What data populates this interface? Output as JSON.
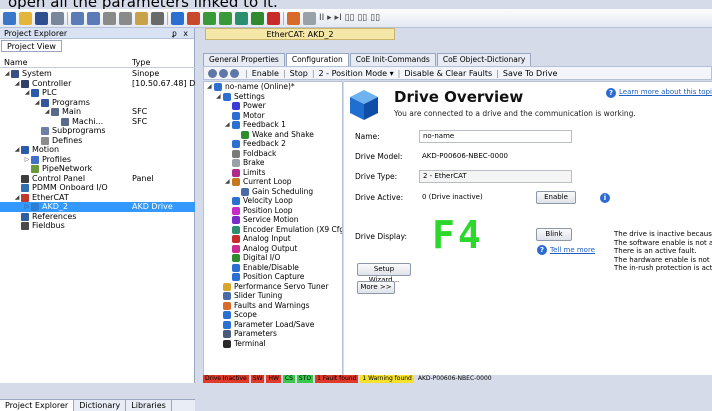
{
  "header_text": "open all the parameters linked to it.",
  "toolbar": {
    "mode_text": "II ▸ ▸I ▯▯ ▯▯ ▯▯"
  },
  "left_pane": {
    "title": "Project Explorer",
    "pin_text": "ᵱ x",
    "view_tab": "Project View",
    "col_name": "Name",
    "col_type": "Type",
    "tree": [
      {
        "label": "System",
        "type": "Sinope",
        "indent": 0,
        "arrow": "◢",
        "icon": "#3a4f85"
      },
      {
        "label": "Controller",
        "type": "[10.50.67.48] Drive",
        "indent": 1,
        "arrow": "◢",
        "icon": "#2f3f66"
      },
      {
        "label": "PLC",
        "type": "",
        "indent": 2,
        "arrow": "◢",
        "icon": "#2a5aa8"
      },
      {
        "label": "Programs",
        "type": "",
        "indent": 3,
        "arrow": "◢",
        "icon": "#33559b"
      },
      {
        "label": "Main",
        "type": "SFC",
        "indent": 4,
        "arrow": "◢",
        "icon": "#5a6a8a"
      },
      {
        "label": "Machi...",
        "type": "SFC",
        "indent": 5,
        "arrow": "",
        "icon": "#5a6a8a"
      },
      {
        "label": "Subprograms",
        "type": "",
        "indent": 3,
        "arrow": "",
        "icon": "#6d7fa5"
      },
      {
        "label": "Defines",
        "type": "",
        "indent": 3,
        "arrow": "",
        "icon": "#8c8c8c"
      },
      {
        "label": "Motion",
        "type": "",
        "indent": 1,
        "arrow": "◢",
        "icon": "#2a5aa8"
      },
      {
        "label": "Profiles",
        "type": "",
        "indent": 2,
        "arrow": "▷",
        "icon": "#4070c8"
      },
      {
        "label": "PipeNetwork",
        "type": "",
        "indent": 2,
        "arrow": "",
        "icon": "#6a9a3a"
      },
      {
        "label": "Control Panel",
        "type": "Panel",
        "indent": 1,
        "arrow": "",
        "icon": "#3d3d3d"
      },
      {
        "label": "PDMM Onboard I/O",
        "type": "",
        "indent": 1,
        "arrow": "",
        "icon": "#2f6fb3"
      },
      {
        "label": "EtherCAT",
        "type": "",
        "indent": 1,
        "arrow": "◢",
        "icon": "#c0392b"
      },
      {
        "label": "AKD_2",
        "type": "AKD Drive",
        "indent": 2,
        "arrow": "▷",
        "icon": "#2b7fd3",
        "selected": true
      },
      {
        "label": "References",
        "type": "",
        "indent": 1,
        "arrow": "",
        "icon": "#2f5fa0"
      },
      {
        "label": "Fieldbus",
        "type": "",
        "indent": 1,
        "arrow": "",
        "icon": "#4a4a4a"
      }
    ],
    "bottom_tabs": [
      "Project Explorer",
      "Dictionary",
      "Libraries"
    ]
  },
  "doc_tab": "EtherCAT: AKD_2",
  "tabs": [
    "General Properties",
    "Configuration",
    "CoE Init-Commands",
    "CoE Object-Dictionary"
  ],
  "active_tab": 1,
  "cmdbar": {
    "enable": "Enable",
    "stop": "Stop",
    "mode": "2 - Position Mode ▾",
    "disable": "Disable & Clear Faults",
    "save": "Save To Drive"
  },
  "inner_tree": [
    {
      "label": "no-name (Online)*",
      "indent": 0,
      "arrow": "◢",
      "icon": "#2b6fd1"
    },
    {
      "label": "Settings",
      "indent": 1,
      "arrow": "◢",
      "icon": "#2b6fd1"
    },
    {
      "label": "Power",
      "indent": 2,
      "arrow": "",
      "icon": "#3a3ad6"
    },
    {
      "label": "Motor",
      "indent": 2,
      "arrow": "",
      "icon": "#2b6fd1"
    },
    {
      "label": "Feedback 1",
      "indent": 2,
      "arrow": "◢",
      "icon": "#2b6fd1"
    },
    {
      "label": "Wake and Shake",
      "indent": 3,
      "arrow": "",
      "icon": "#2e8b2e"
    },
    {
      "label": "Feedback 2",
      "indent": 2,
      "arrow": "",
      "icon": "#2b6fd1"
    },
    {
      "label": "Foldback",
      "indent": 2,
      "arrow": "",
      "icon": "#7a7a7a"
    },
    {
      "label": "Brake",
      "indent": 2,
      "arrow": "",
      "icon": "#9aa0a8"
    },
    {
      "label": "Limits",
      "indent": 2,
      "arrow": "",
      "icon": "#b02a8a"
    },
    {
      "label": "Current Loop",
      "indent": 2,
      "arrow": "◢",
      "icon": "#c47a1a"
    },
    {
      "label": "Gain Scheduling",
      "indent": 3,
      "arrow": "",
      "icon": "#4a6aa8"
    },
    {
      "label": "Velocity Loop",
      "indent": 2,
      "arrow": "",
      "icon": "#2b6fd1"
    },
    {
      "label": "Position Loop",
      "indent": 2,
      "arrow": "",
      "icon": "#c92bc9"
    },
    {
      "label": "Service Motion",
      "indent": 2,
      "arrow": "",
      "icon": "#7a2bc9"
    },
    {
      "label": "Encoder Emulation (X9 Cfg)",
      "indent": 2,
      "arrow": "",
      "icon": "#2b8f6f"
    },
    {
      "label": "Analog Input",
      "indent": 2,
      "arrow": "",
      "icon": "#c92b2b"
    },
    {
      "label": "Analog Output",
      "indent": 2,
      "arrow": "",
      "icon": "#c92b8f"
    },
    {
      "label": "Digital I/O",
      "indent": 2,
      "arrow": "",
      "icon": "#2e8b2e"
    },
    {
      "label": "Enable/Disable",
      "indent": 2,
      "arrow": "",
      "icon": "#2b6fd1"
    },
    {
      "label": "Position Capture",
      "indent": 2,
      "arrow": "",
      "icon": "#2b6fd1"
    },
    {
      "label": "Performance Servo Tuner",
      "indent": 1,
      "arrow": "",
      "icon": "#d8a62b"
    },
    {
      "label": "Slider Tuning",
      "indent": 1,
      "arrow": "",
      "icon": "#4a6aa8"
    },
    {
      "label": "Faults and Warnings",
      "indent": 1,
      "arrow": "",
      "icon": "#d86a2b"
    },
    {
      "label": "Scope",
      "indent": 1,
      "arrow": "",
      "icon": "#2b6fd1"
    },
    {
      "label": "Parameter Load/Save",
      "indent": 1,
      "arrow": "",
      "icon": "#2b6fd1"
    },
    {
      "label": "Parameters",
      "indent": 1,
      "arrow": "",
      "icon": "#4a5a7a"
    },
    {
      "label": "Terminal",
      "indent": 1,
      "arrow": "",
      "icon": "#2a2a2a"
    }
  ],
  "overview": {
    "title": "Drive Overview",
    "subtitle": "You are connected to a drive and the communication is working.",
    "learn_more": "Learn more about this topic",
    "name_label": "Name:",
    "name_value": "no-name",
    "model_label": "Drive Model:",
    "model_value": "AKD-P00606-NBEC-0000",
    "type_label": "Drive Type:",
    "type_value": "2 - EtherCAT",
    "active_label": "Drive Active:",
    "active_value": "0 (Drive inactive)",
    "enable_btn": "Enable",
    "display_label": "Drive Display:",
    "display_value": "F4",
    "blink_btn": "Blink",
    "tell_more": "Tell me more",
    "setup_btn": "Setup Wizard...",
    "more_btn": "More >>",
    "warn_lines": [
      "The drive is inactive because:",
      "The software enable is not active.",
      "There is an active fault.",
      "The hardware enable is not active.",
      "The in-rush protection is active."
    ]
  },
  "statusbar": [
    {
      "text": "Drive Inactive",
      "bg": "#e03a2b"
    },
    {
      "text": "SW",
      "bg": "#e03a2b"
    },
    {
      "text": "HW",
      "bg": "#e03a2b"
    },
    {
      "text": "CS",
      "bg": "#39c94a"
    },
    {
      "text": "STO",
      "bg": "#39c94a"
    },
    {
      "text": "1 Fault found",
      "bg": "#e03a2b"
    },
    {
      "text": "1 Warning found",
      "bg": "#f6e12b"
    },
    {
      "text": "AKD-P00606-NBEC-0000",
      "bg": "transparent"
    }
  ],
  "colors": {
    "accent": "#3399ff",
    "display_green": "#2bd82b"
  }
}
